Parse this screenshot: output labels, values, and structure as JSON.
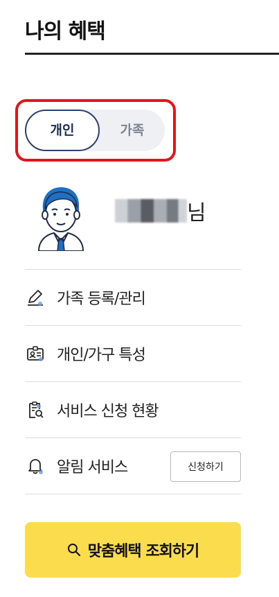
{
  "page": {
    "title": "나의 혜택"
  },
  "toggle": {
    "options": [
      {
        "label": "개인",
        "selected": true
      },
      {
        "label": "가족",
        "selected": false
      }
    ]
  },
  "profile": {
    "name_suffix": "님",
    "avatar_icon": "user-avatar-icon"
  },
  "menu": {
    "items": [
      {
        "label": "가족 등록/관리",
        "icon": "pencil-icon"
      },
      {
        "label": "개인/가구 특성",
        "icon": "id-card-icon"
      },
      {
        "label": "서비스 신청 현황",
        "icon": "clipboard-search-icon"
      },
      {
        "label": "알림 서비스",
        "icon": "bell-icon",
        "action_label": "신청하기"
      }
    ]
  },
  "search_button": {
    "label": "맞춤혜택 조회하기",
    "icon": "search-icon"
  },
  "colors": {
    "accent_yellow": "#fbdc4c",
    "active_navy": "#1d2d56",
    "highlight_red": "#e4141b",
    "icon_blue": "#6f9ad8"
  }
}
